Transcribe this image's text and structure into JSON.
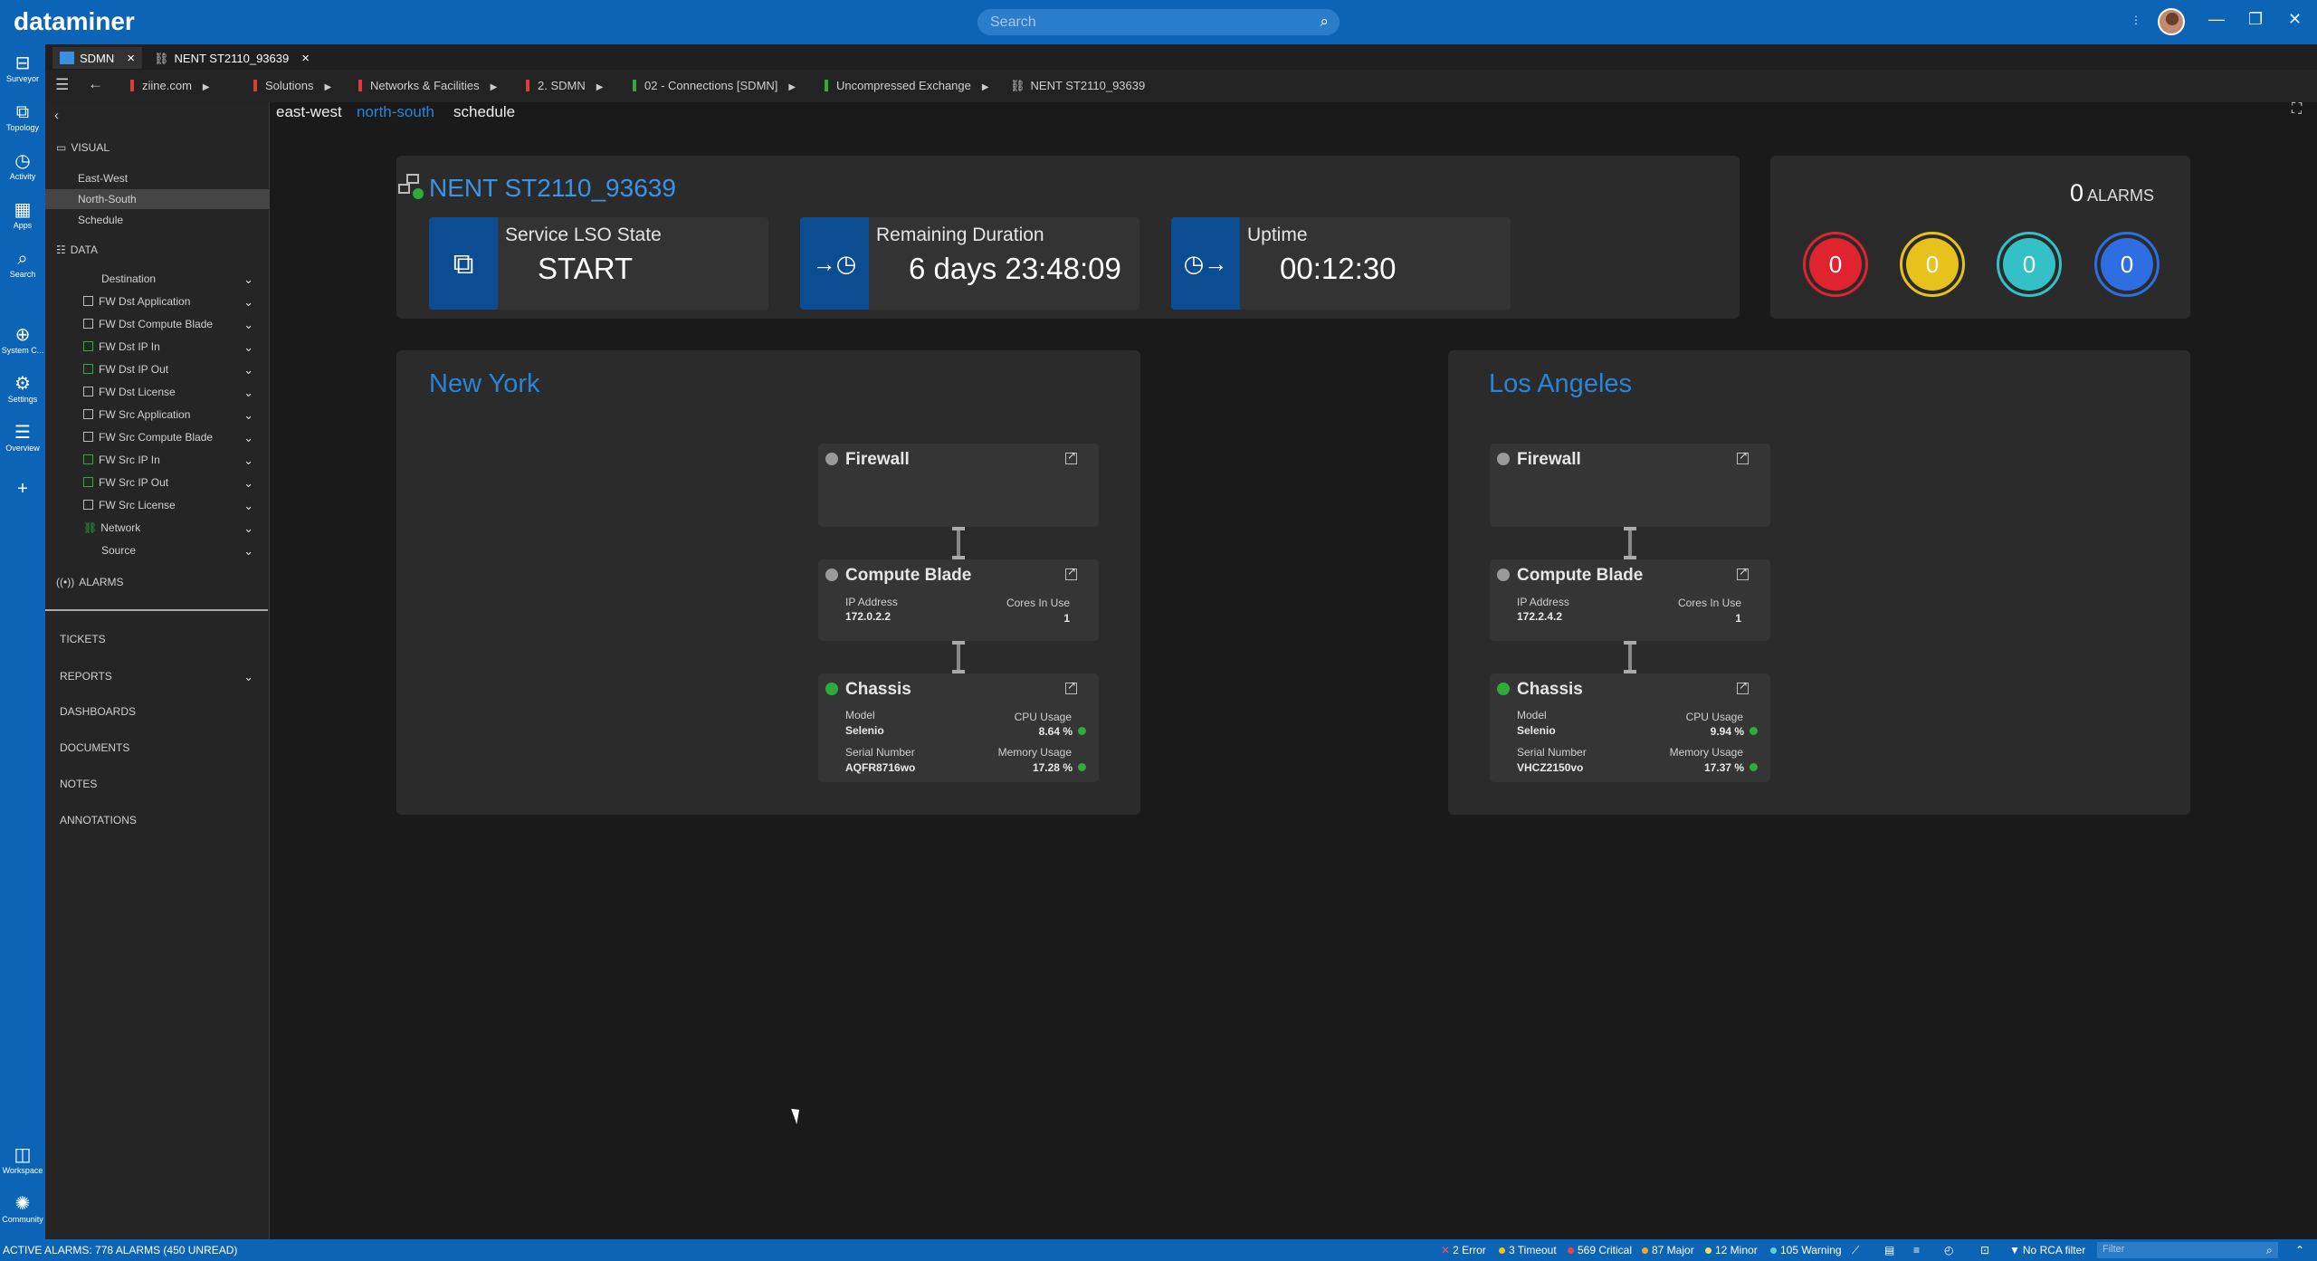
{
  "app": {
    "logo": "dataminer",
    "search_placeholder": "Search"
  },
  "left_nav": [
    {
      "label": "Surveyor",
      "icon": "surveyor-icon"
    },
    {
      "label": "Topology",
      "icon": "topology-icon"
    },
    {
      "label": "Activity",
      "icon": "activity-icon"
    },
    {
      "label": "Apps",
      "icon": "apps-icon"
    },
    {
      "label": "Search",
      "icon": "search-icon"
    },
    {
      "label": "System C...",
      "icon": "globe-icon"
    },
    {
      "label": "Settings",
      "icon": "gear-icon"
    },
    {
      "label": "Overview",
      "icon": "overview-icon"
    },
    {
      "label": "Workspace",
      "icon": "workspace-icon"
    },
    {
      "label": "Community",
      "icon": "community-icon"
    }
  ],
  "tabs": [
    {
      "label": "SDMN",
      "close": "×"
    },
    {
      "label": "NENT ST2110_93639",
      "close": "×"
    }
  ],
  "breadcrumbs": [
    {
      "label": "ziine.com",
      "color": "#e03b3b"
    },
    {
      "label": "Solutions",
      "color": "#e03b3b"
    },
    {
      "label": "Networks & Facilities",
      "color": "#e03b3b"
    },
    {
      "label": "2. SDMN",
      "color": "#e03b3b"
    },
    {
      "label": "02 - Connections [SDMN]",
      "color": "#2eac3a"
    },
    {
      "label": "Uncompressed Exchange",
      "color": "#2eac3a"
    },
    {
      "label": "NENT ST2110_93639",
      "color": ""
    }
  ],
  "sidebar": {
    "visual_header": "VISUAL",
    "visual_items": [
      "East-West",
      "North-South",
      "Schedule"
    ],
    "data_header": "DATA",
    "data_items": [
      "Destination",
      "FW Dst Application",
      "FW Dst Compute Blade",
      "FW Dst IP In",
      "FW Dst IP Out",
      "FW Dst License",
      "FW Src Application",
      "FW Src Compute Blade",
      "FW Src IP In",
      "FW Src IP Out",
      "FW Src License",
      "Network",
      "Source"
    ],
    "alarms_header": "ALARMS",
    "bottom_items": [
      "TICKETS",
      "REPORTS",
      "DASHBOARDS",
      "DOCUMENTS",
      "NOTES",
      "ANNOTATIONS"
    ]
  },
  "subtabs": [
    "east-west",
    "north-south",
    "schedule"
  ],
  "service": {
    "title": "NENT ST2110_93639",
    "kpis": [
      {
        "label": "Service LSO State",
        "value": "START",
        "icon": "service-state-icon"
      },
      {
        "label": "Remaining Duration",
        "value": "6 days 23:48:09",
        "icon": "clock-arrow-in-icon"
      },
      {
        "label": "Uptime",
        "value": "00:12:30",
        "icon": "clock-arrow-out-icon"
      }
    ]
  },
  "alarms": {
    "count": "0",
    "label": "ALARMS",
    "bubbles": [
      {
        "value": "0",
        "color": "#e0242f"
      },
      {
        "value": "0",
        "color": "#e8c21c"
      },
      {
        "value": "0",
        "color": "#33c1c7"
      },
      {
        "value": "0",
        "color": "#2f6ee0"
      }
    ]
  },
  "sites": [
    {
      "name": "New York",
      "firewall": {
        "name": "Firewall"
      },
      "blade": {
        "name": "Compute Blade",
        "ip_label": "IP Address",
        "ip": "172.0.2.2",
        "cores_label": "Cores In Use",
        "cores": "1"
      },
      "chassis": {
        "name": "Chassis",
        "model_label": "Model",
        "model": "Selenio",
        "serial_label": "Serial Number",
        "serial": "AQFR8716wo",
        "cpu_label": "CPU Usage",
        "cpu": "8.64 %",
        "mem_label": "Memory Usage",
        "mem": "17.28 %"
      }
    },
    {
      "name": "Los Angeles",
      "firewall": {
        "name": "Firewall"
      },
      "blade": {
        "name": "Compute Blade",
        "ip_label": "IP Address",
        "ip": "172.2.4.2",
        "cores_label": "Cores In Use",
        "cores": "1"
      },
      "chassis": {
        "name": "Chassis",
        "model_label": "Model",
        "model": "Selenio",
        "serial_label": "Serial Number",
        "serial": "VHCZ2150vo",
        "cpu_label": "CPU Usage",
        "cpu": "9.94 %",
        "mem_label": "Memory Usage",
        "mem": "17.37 %"
      }
    }
  ],
  "statusbar": {
    "active_alarms": "ACTIVE ALARMS: 778 ALARMS (450 UNREAD)",
    "error": "2 Error",
    "timeout": "3 Timeout",
    "critical": "569 Critical",
    "major": "87 Major",
    "minor": "12 Minor",
    "warning": "105 Warning",
    "rca": "No RCA filter",
    "filter_placeholder": "Filter"
  }
}
